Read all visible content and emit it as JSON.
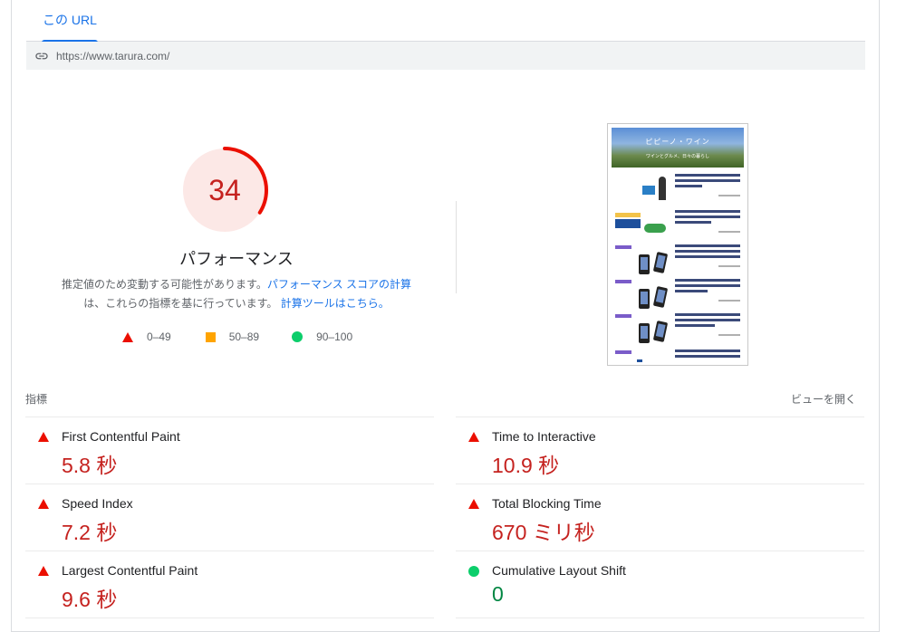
{
  "tabs": [
    {
      "label": "この URL"
    }
  ],
  "url": "https://www.tarura.com/",
  "performance": {
    "score": "34",
    "score_fraction": 0.34,
    "title": "パフォーマンス",
    "desc_part1": "推定値のため変動する可能性があります。",
    "desc_link1": "パフォーマンス スコアの計算",
    "desc_part2": "は、これらの指標を基に行っています。",
    "desc_link2": "計算ツールはこちら。",
    "legend": [
      {
        "shape": "triangle",
        "range": "0–49",
        "color": "#eb0f00"
      },
      {
        "shape": "square",
        "range": "50–89",
        "color": "#ffa400"
      },
      {
        "shape": "circle",
        "range": "90–100",
        "color": "#0cce6b"
      }
    ]
  },
  "screenshot": {
    "hero_title": "ピピーノ・ワイン",
    "hero_subtitle": "ワインとグルメ、日々の暮らし"
  },
  "metrics": {
    "header": "指標",
    "expand_label": "ビューを開く",
    "left": [
      {
        "name": "First Contentful Paint",
        "value": "5.8 秒",
        "status": "poor"
      },
      {
        "name": "Speed Index",
        "value": "7.2 秒",
        "status": "poor"
      },
      {
        "name": "Largest Contentful Paint",
        "value": "9.6 秒",
        "status": "poor"
      }
    ],
    "right": [
      {
        "name": "Time to Interactive",
        "value": "10.9 秒",
        "status": "poor"
      },
      {
        "name": "Total Blocking Time",
        "value": "670 ミリ秒",
        "status": "poor"
      },
      {
        "name": "Cumulative Layout Shift",
        "value": "0",
        "status": "good"
      }
    ]
  },
  "colors": {
    "poor": "#c5221f",
    "good": "#018642",
    "accent": "#1a73e8"
  }
}
